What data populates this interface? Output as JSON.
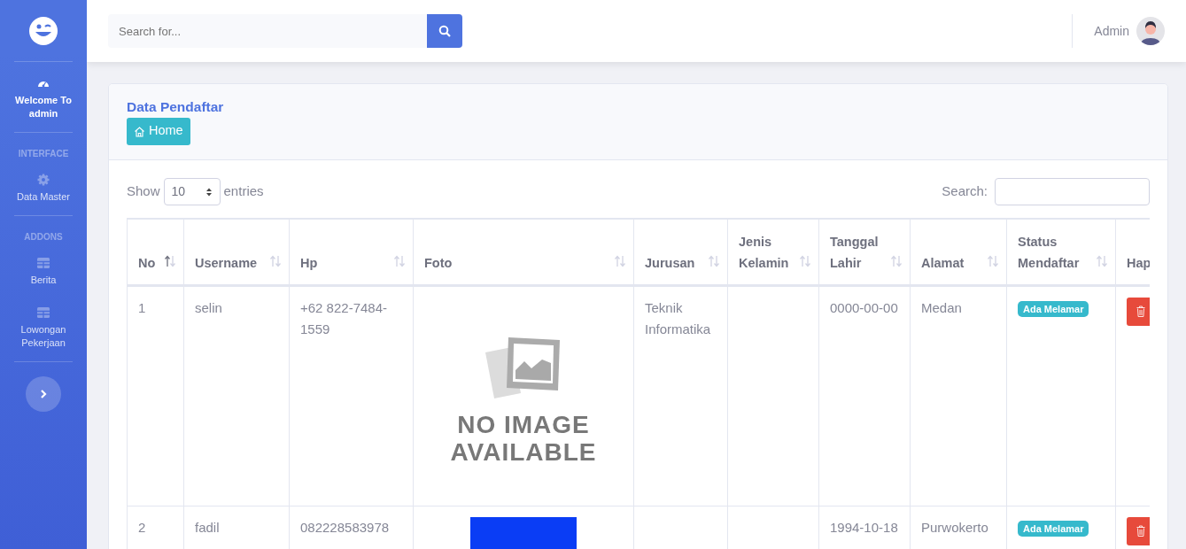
{
  "sidebar": {
    "items": [
      {
        "kind": "link",
        "label": "Welcome To admin",
        "selected": true
      },
      {
        "kind": "heading",
        "label": "INTERFACE"
      },
      {
        "kind": "link",
        "label": "Data Master",
        "selected": false
      },
      {
        "kind": "heading",
        "label": "ADDONS"
      },
      {
        "kind": "link",
        "label": "Berita",
        "selected": false
      },
      {
        "kind": "link",
        "label": "Lowongan Pekerjaan",
        "selected": false
      }
    ]
  },
  "topbar": {
    "search": {
      "placeholder": "Search for..."
    },
    "user": "Admin"
  },
  "card": {
    "title": "Data Pendaftar",
    "home_button": "Home"
  },
  "table_controls": {
    "show_label": "Show",
    "entries_value": "10",
    "entries_label": "entries",
    "search_label": "Search:"
  },
  "table": {
    "columns": [
      {
        "label": "No",
        "sorted": true
      },
      {
        "label": "Username",
        "sorted": false
      },
      {
        "label": "Hp",
        "sorted": false
      },
      {
        "label": "Foto",
        "sorted": false
      },
      {
        "label": "Jurusan",
        "sorted": false
      },
      {
        "label": "Jenis Kelamin",
        "sorted": false
      },
      {
        "label": "Tanggal Lahir",
        "sorted": false
      },
      {
        "label": "Alamat",
        "sorted": false
      },
      {
        "label": "Status Mendaftar",
        "sorted": false
      },
      {
        "label": "Hap"
      }
    ],
    "rows": [
      {
        "no": "1",
        "username": "selin",
        "hp": "+62 822-7484-1559",
        "foto": {
          "kind": "no_image",
          "lines": [
            "NO IMAGE",
            "AVAILABLE"
          ]
        },
        "jurusan": "Teknik Informatika",
        "tanggal_lahir": "0000-00-00",
        "alamat": "Medan",
        "status": "Ada Melamar"
      },
      {
        "no": "2",
        "username": "fadil",
        "hp": "082228583978",
        "foto": {
          "kind": "photo"
        },
        "tanggal_lahir": "1994-10-18",
        "alamat": "Purwokerto",
        "status": "Ada Melamar"
      }
    ]
  }
}
